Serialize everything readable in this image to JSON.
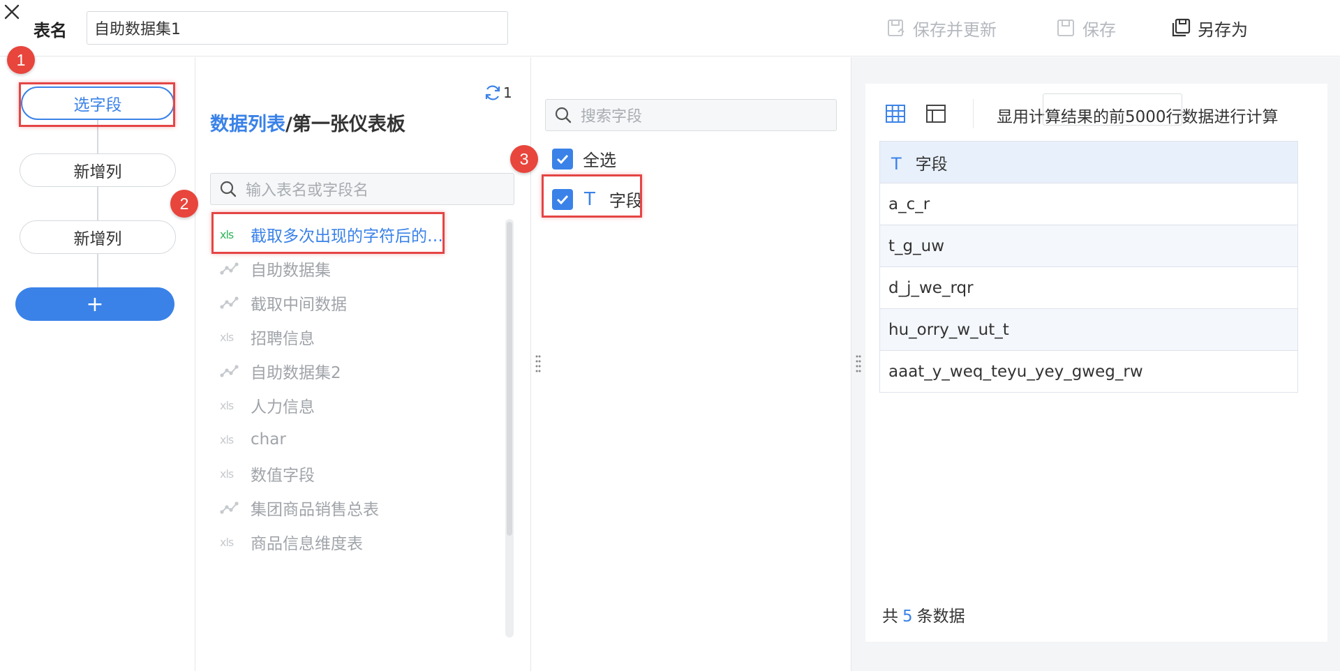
{
  "header": {
    "table_name_label": "表名",
    "table_name_value": "自助数据集1",
    "save_update_label": "保存并更新",
    "save_label": "保存",
    "save_as_label": "另存为"
  },
  "steps": {
    "select_fields": "选字段",
    "add_column_1": "新增列",
    "add_column_2": "新增列",
    "add_step": "+"
  },
  "badges": [
    "1",
    "2",
    "3"
  ],
  "datalist": {
    "refresh_count": "1",
    "title_part1": "数据列表",
    "title_part2": "/第一张仪表板",
    "search_placeholder": "输入表名或字段名",
    "items": [
      {
        "icon": "xls",
        "label": "截取多次出现的字符后的…",
        "active": true
      },
      {
        "icon": "self-service",
        "label": "自助数据集"
      },
      {
        "icon": "self-service",
        "label": "截取中间数据"
      },
      {
        "icon": "xls",
        "label": "招聘信息"
      },
      {
        "icon": "self-service",
        "label": "自助数据集2"
      },
      {
        "icon": "xls",
        "label": "人力信息"
      },
      {
        "icon": "xls",
        "label": "char"
      },
      {
        "icon": "xls",
        "label": "数值字段"
      },
      {
        "icon": "self-service",
        "label": "集团商品销售总表"
      },
      {
        "icon": "xls",
        "label": "商品信息维度表"
      }
    ]
  },
  "fields": {
    "search_placeholder": "搜索字段",
    "select_all_label": "全选",
    "field_label": "字段",
    "text_type_glyph": "T"
  },
  "preview": {
    "calc_text": "显用计算结果的前5000行数据进行计算",
    "column_header": "字段",
    "rows": [
      "a_c_r",
      "t_g_uw",
      "d_j_we_rqr",
      "hu_orry_w_ut_t",
      "aaat_y_weq_teyu_yey_gweg_rw"
    ],
    "count_prefix": "共",
    "count_value": "5",
    "count_suffix": "条数据"
  },
  "colors": {
    "accent": "#3a82e8",
    "highlight_box": "#e54545",
    "badge": "#e8453c",
    "xls_green": "#2fb45b"
  }
}
